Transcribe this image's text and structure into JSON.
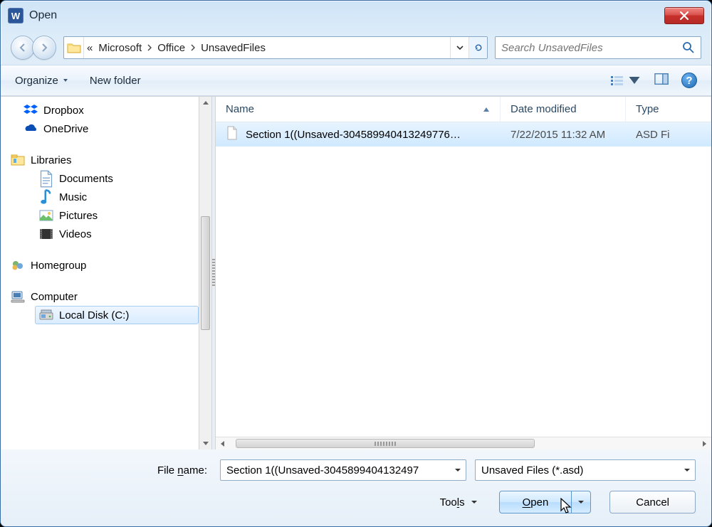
{
  "window": {
    "title": "Open"
  },
  "breadcrumbs": {
    "prefix": "«",
    "seg1": "Microsoft",
    "seg2": "Office",
    "seg3": "UnsavedFiles"
  },
  "search": {
    "placeholder": "Search UnsavedFiles"
  },
  "toolbar": {
    "organize": "Organize",
    "newfolder": "New folder"
  },
  "sidebar": {
    "dropbox": "Dropbox",
    "onedrive": "OneDrive",
    "libraries": "Libraries",
    "documents": "Documents",
    "music": "Music",
    "pictures": "Pictures",
    "videos": "Videos",
    "homegroup": "Homegroup",
    "computer": "Computer",
    "localdisk": "Local Disk (C:)"
  },
  "columns": {
    "name": "Name",
    "date": "Date modified",
    "type": "Type"
  },
  "file": {
    "name": "Section 1((Unsaved-304589940413249776…",
    "date": "7/22/2015 11:32 AM",
    "type": "ASD Fi"
  },
  "footer": {
    "filenamelabel": "File name:",
    "filename": "Section 1((Unsaved-3045899404132497",
    "filter": "Unsaved Files (*.asd)",
    "tools": "Tools",
    "open": "Open",
    "cancel": "Cancel"
  }
}
